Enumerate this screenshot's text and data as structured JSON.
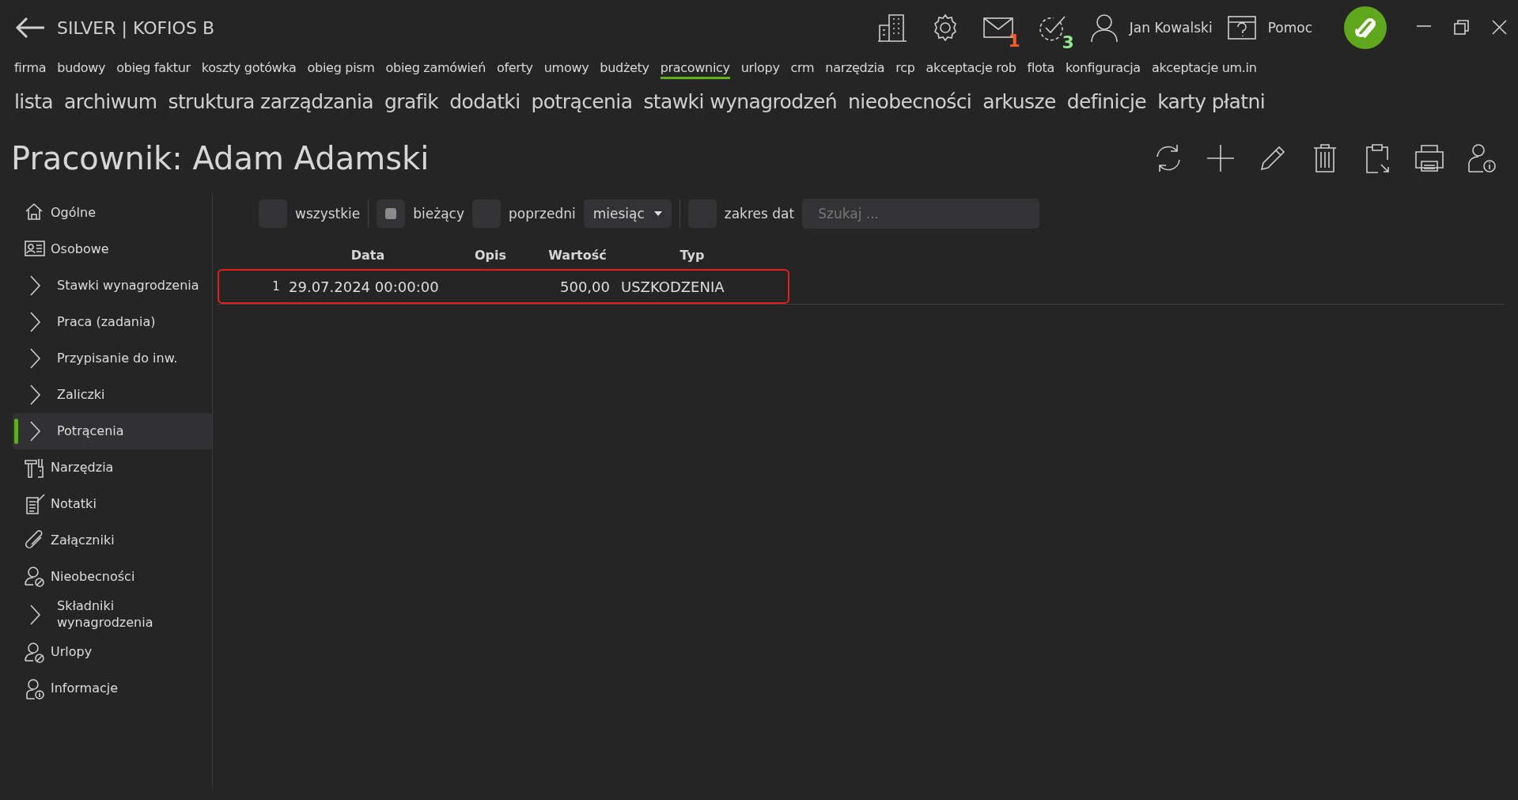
{
  "window": {
    "title": "SILVER | KOFIOS B"
  },
  "header": {
    "mail_count": "1",
    "tasks_count": "3",
    "user": "Jan Kowalski",
    "help": "Pomoc"
  },
  "modules": [
    {
      "label": "firma",
      "selected": false
    },
    {
      "label": "budowy",
      "selected": false
    },
    {
      "label": "obieg faktur",
      "selected": false
    },
    {
      "label": "koszty gotówka",
      "selected": false
    },
    {
      "label": "obieg pism",
      "selected": false
    },
    {
      "label": "obieg zamówień",
      "selected": false
    },
    {
      "label": "oferty",
      "selected": false
    },
    {
      "label": "umowy",
      "selected": false
    },
    {
      "label": "budżety",
      "selected": false
    },
    {
      "label": "pracownicy",
      "selected": true
    },
    {
      "label": "urlopy",
      "selected": false
    },
    {
      "label": "crm",
      "selected": false
    },
    {
      "label": "narzędzia",
      "selected": false
    },
    {
      "label": "rcp",
      "selected": false
    },
    {
      "label": "akceptacje rob",
      "selected": false
    },
    {
      "label": "flota",
      "selected": false
    },
    {
      "label": "konfiguracja",
      "selected": false
    },
    {
      "label": "akceptacje um.in",
      "selected": false
    }
  ],
  "submenu": [
    "lista",
    "archiwum",
    "struktura zarządzania",
    "grafik",
    "dodatki",
    "potrącenia",
    "stawki wynagrodzeń",
    "nieobecności",
    "arkusze",
    "definicje",
    "karty płatni"
  ],
  "page_title": "Pracownik: Adam Adamski",
  "sidebar": [
    {
      "label": "Ogólne",
      "kind": "page",
      "selected": false
    },
    {
      "label": "Osobowe",
      "kind": "page",
      "selected": false
    },
    {
      "label": "Stawki wynagrodzenia",
      "kind": "group",
      "selected": false
    },
    {
      "label": "Praca (zadania)",
      "kind": "group",
      "selected": false
    },
    {
      "label": "Przypisanie do inw.",
      "kind": "group",
      "selected": false
    },
    {
      "label": "Zaliczki",
      "kind": "group",
      "selected": false
    },
    {
      "label": "Potrącenia",
      "kind": "group",
      "selected": true
    },
    {
      "label": "Narzędzia",
      "kind": "page",
      "selected": false
    },
    {
      "label": "Notatki",
      "kind": "page",
      "selected": false
    },
    {
      "label": "Załączniki",
      "kind": "page",
      "selected": false
    },
    {
      "label": "Nieobecności",
      "kind": "page",
      "selected": false
    },
    {
      "label": "Składniki wynagrodzenia",
      "kind": "group",
      "selected": false
    },
    {
      "label": "Urlopy",
      "kind": "page",
      "selected": false
    },
    {
      "label": "Informacje",
      "kind": "page",
      "selected": false
    }
  ],
  "filters": [
    {
      "kind": "checkbox",
      "label": "wszystkie",
      "checked": false
    },
    {
      "kind": "checkbox",
      "label": "bieżący",
      "checked": true
    },
    {
      "kind": "checkbox",
      "label": "poprzedni",
      "checked": false
    },
    {
      "kind": "dropdown",
      "label": "miesiąc"
    },
    {
      "kind": "checkbox",
      "label": "zakres dat",
      "checked": false
    },
    {
      "kind": "search",
      "placeholder": "Szukaj ..."
    }
  ],
  "table": {
    "columns": [
      "Data",
      "Opis",
      "Wartość",
      "Typ"
    ],
    "rows": [
      {
        "number": "1",
        "data": "29.07.2024 00:00:00",
        "wartosc": "500,00",
        "typ": "USZKODZENIA",
        "highlighted": true
      }
    ]
  }
}
